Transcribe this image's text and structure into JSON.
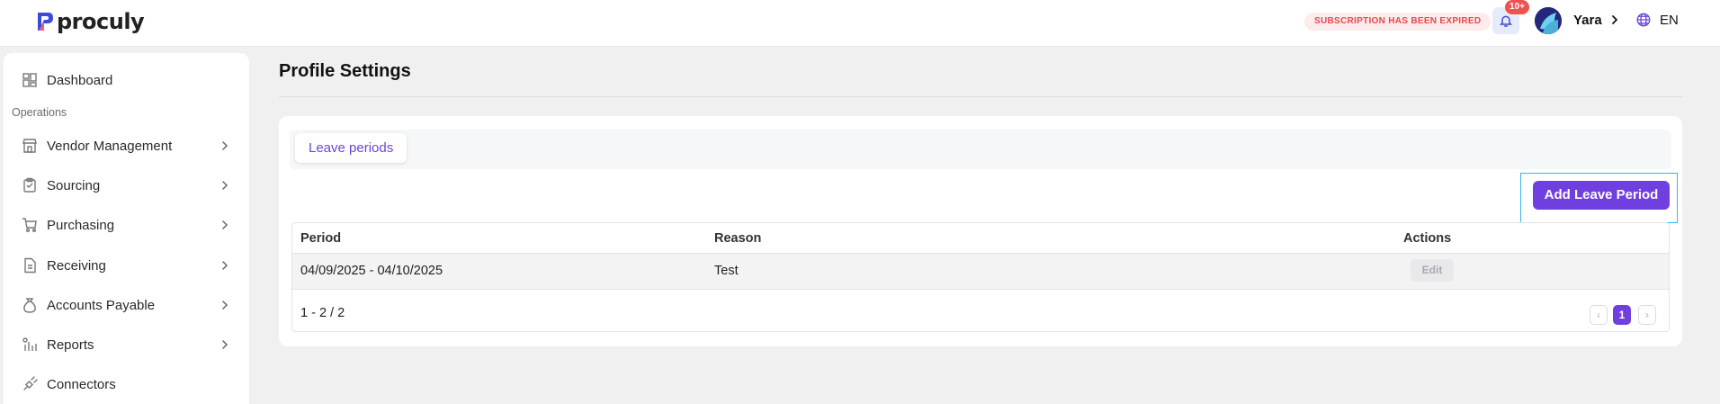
{
  "header": {
    "logo_text": "proculy",
    "subscription_notice": "SUBSCRIPTION HAS BEEN EXPIRED",
    "notification_badge": "10+",
    "user_name": "Yara",
    "language": "EN",
    "icons": [
      "bell-icon",
      "avatar",
      "chevron-right-icon",
      "globe-icon"
    ]
  },
  "sidebar": {
    "dashboard_label": "Dashboard",
    "section_label": "Operations",
    "items": [
      {
        "label": "Vendor Management",
        "icon": "store-icon"
      },
      {
        "label": "Sourcing",
        "icon": "clipboard-icon"
      },
      {
        "label": "Purchasing",
        "icon": "cart-icon"
      },
      {
        "label": "Receiving",
        "icon": "document-icon"
      },
      {
        "label": "Accounts Payable",
        "icon": "money-bag-icon"
      },
      {
        "label": "Reports",
        "icon": "chart-icon"
      }
    ],
    "connectors_label": "Connectors"
  },
  "main": {
    "title": "Profile Settings",
    "tabs": [
      {
        "label": "Leave periods",
        "active": true
      }
    ],
    "add_button_label": "Add Leave Period",
    "table": {
      "headers": [
        "Period",
        "Reason",
        "Actions"
      ],
      "rows": [
        {
          "period": "04/09/2025 - 04/10/2025",
          "reason": "Test",
          "action": "Edit"
        }
      ]
    },
    "pagination": {
      "range_text": "1 - 2 / 2",
      "prev": "‹",
      "current_page": "1",
      "next": "›"
    }
  },
  "colors": {
    "accent": "#6f3fe0",
    "expired_text": "#e5484d",
    "badge": "#f05252",
    "focus_outline": "#33b8e8"
  }
}
